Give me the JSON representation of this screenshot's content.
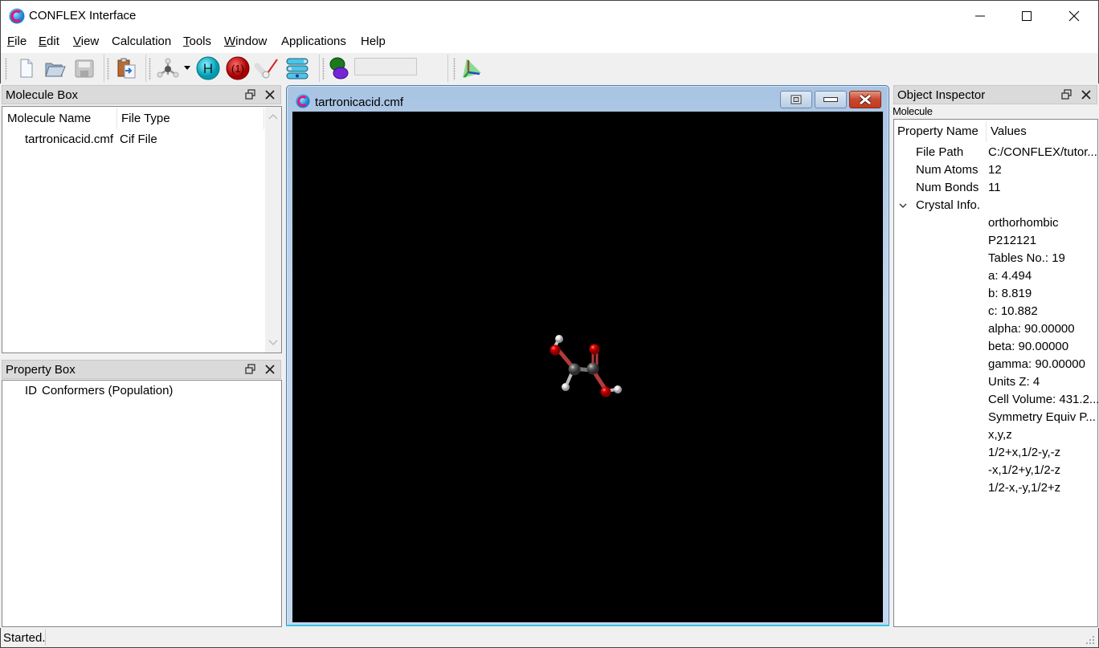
{
  "window": {
    "title": "CONFLEX Interface",
    "icon": "conflex-logo-icon",
    "controls": [
      "minimize-icon",
      "maximize-icon",
      "close-icon"
    ]
  },
  "menubar": {
    "items": [
      {
        "label": "File",
        "mnemonic": "F",
        "rest": "ile"
      },
      {
        "label": "Edit",
        "mnemonic": "E",
        "rest": "dit"
      },
      {
        "label": "View",
        "mnemonic": "V",
        "rest": "iew"
      },
      {
        "label": "Calculation",
        "mnemonic": "",
        "rest": "Calculation"
      },
      {
        "label": "Tools",
        "mnemonic": "T",
        "rest": "ools"
      },
      {
        "label": "Window",
        "mnemonic": "W",
        "rest": "indow"
      },
      {
        "label": "Applications",
        "mnemonic": "",
        "rest": "Applications"
      },
      {
        "label": "Help",
        "mnemonic": "",
        "rest": "Help"
      }
    ]
  },
  "toolbar": {
    "buttons": [
      {
        "name": "new-file",
        "icon": "new-document-icon"
      },
      {
        "name": "open-file",
        "icon": "open-folder-icon"
      },
      {
        "name": "save-file",
        "icon": "save-disk-icon"
      },
      {
        "name": "paste-import",
        "icon": "clipboard-paste-icon"
      },
      {
        "name": "build-molecule",
        "icon": "molecule-builder-icon"
      },
      {
        "name": "add-hydrogen",
        "icon": "hydrogen-atom-icon",
        "glyph": "H"
      },
      {
        "name": "charge",
        "icon": "charge-atom-icon",
        "glyph": "(1)"
      },
      {
        "name": "measure",
        "icon": "measure-angle-icon"
      },
      {
        "name": "conformer-list",
        "icon": "conformer-stack-icon"
      },
      {
        "name": "orbital",
        "icon": "orbital-icon"
      },
      {
        "name": "axis-view",
        "icon": "axis-tetrahedron-icon"
      }
    ],
    "text_field_value": ""
  },
  "molecule_box": {
    "title": "Molecule Box",
    "columns": [
      "Molecule Name",
      "File Type"
    ],
    "rows": [
      {
        "name": "tartronicacid.cmf",
        "type": "Cif File"
      }
    ]
  },
  "property_box": {
    "title": "Property Box",
    "columns": [
      "ID",
      "Conformers (Population)"
    ]
  },
  "mdi_window": {
    "title": "tartronicacid.cmf",
    "viewport_background": "#000000"
  },
  "object_inspector": {
    "title": "Object Inspector",
    "subtitle": "Molecule",
    "columns": [
      "Property Name",
      "Values"
    ],
    "properties": [
      {
        "name": "File Path",
        "value": "C:/CONFLEX/tutor..."
      },
      {
        "name": "Num Atoms",
        "value": "12"
      },
      {
        "name": "Num Bonds",
        "value": "11"
      }
    ],
    "crystal_group": {
      "name": "Crystal Info.",
      "expanded": true,
      "values": [
        "orthorhombic",
        "P212121",
        "Tables No.: 19",
        "a: 4.494",
        "b: 8.819",
        "c: 10.882",
        "alpha: 90.00000",
        "beta: 90.00000",
        "gamma: 90.00000",
        "Units Z: 4",
        "Cell Volume: 431.2...",
        "Symmetry Equiv P...",
        "x,y,z",
        "1/2+x,1/2-y,-z",
        "-x,1/2+y,1/2-z",
        "1/2-x,-y,1/2+z"
      ]
    }
  },
  "statusbar": {
    "text": "Started."
  },
  "colors": {
    "oxygen": "#d40000",
    "carbon": "#5a5a5a",
    "hydrogen": "#e8e8e8",
    "mdi_close": "#c9462c"
  }
}
